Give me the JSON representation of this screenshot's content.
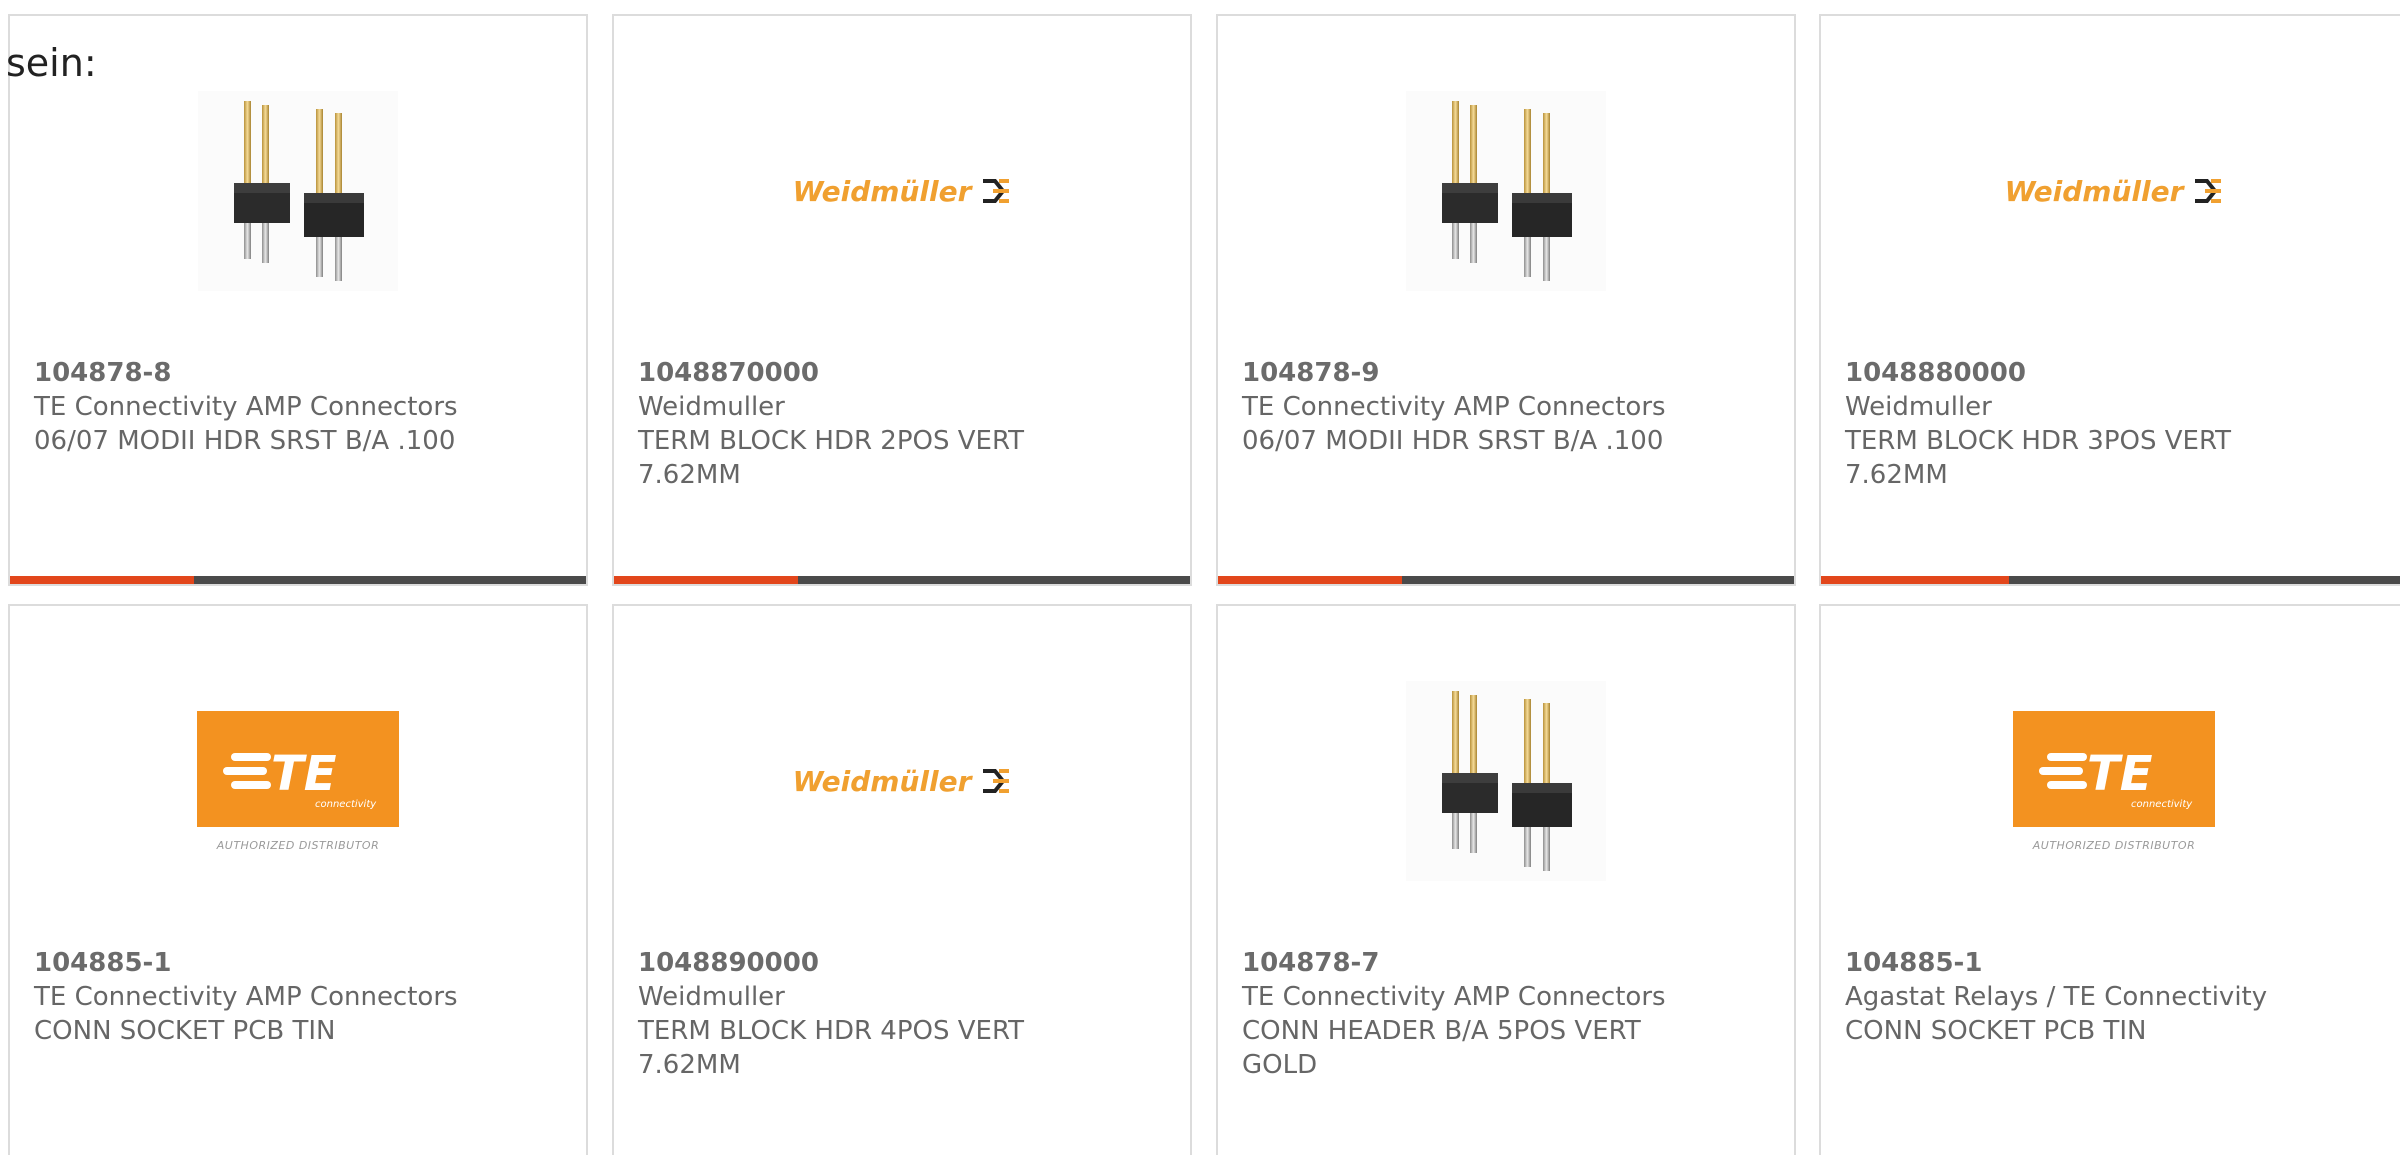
{
  "intro_text": "sein:",
  "logos": {
    "weidmuller": "Weidmüller",
    "te_letters": "TE",
    "te_tagline": "connectivity",
    "te_subtitle": "AUTHORIZED DISTRIBUTOR"
  },
  "accent_color": "#e2461b",
  "track_color": "#4a4a4a",
  "products": [
    {
      "part_number": "104878-8",
      "manufacturer": "TE Connectivity AMP Connectors",
      "desc1": "06/07 MODII HDR SRST B/A .100",
      "desc2": "",
      "image": "pin-header-icon",
      "progress": 0.32
    },
    {
      "part_number": "1048870000",
      "manufacturer": "Weidmuller",
      "desc1": "TERM BLOCK HDR 2POS VERT",
      "desc2": "7.62MM",
      "image": "weidmuller-logo",
      "progress": 0.32
    },
    {
      "part_number": "104878-9",
      "manufacturer": "TE Connectivity AMP Connectors",
      "desc1": "06/07 MODII HDR SRST B/A .100",
      "desc2": "",
      "image": "pin-header-icon",
      "progress": 0.32
    },
    {
      "part_number": "1048880000",
      "manufacturer": "Weidmuller",
      "desc1": "TERM BLOCK HDR 3POS VERT",
      "desc2": "7.62MM",
      "image": "weidmuller-logo",
      "progress": 0.32
    },
    {
      "part_number": "104885-1",
      "manufacturer": "TE Connectivity AMP Connectors",
      "desc1": "CONN SOCKET PCB TIN",
      "desc2": "",
      "image": "te-logo",
      "progress": null
    },
    {
      "part_number": "1048890000",
      "manufacturer": "Weidmuller",
      "desc1": "TERM BLOCK HDR 4POS VERT",
      "desc2": "7.62MM",
      "image": "weidmuller-logo",
      "progress": null
    },
    {
      "part_number": "104878-7",
      "manufacturer": "TE Connectivity AMP Connectors",
      "desc1": "CONN HEADER B/A 5POS VERT",
      "desc2": "GOLD",
      "image": "pin-header-icon",
      "progress": null
    },
    {
      "part_number": "104885-1",
      "manufacturer": "Agastat Relays / TE Connectivity",
      "desc1": "CONN SOCKET PCB TIN",
      "desc2": "",
      "image": "te-logo",
      "progress": null
    }
  ]
}
